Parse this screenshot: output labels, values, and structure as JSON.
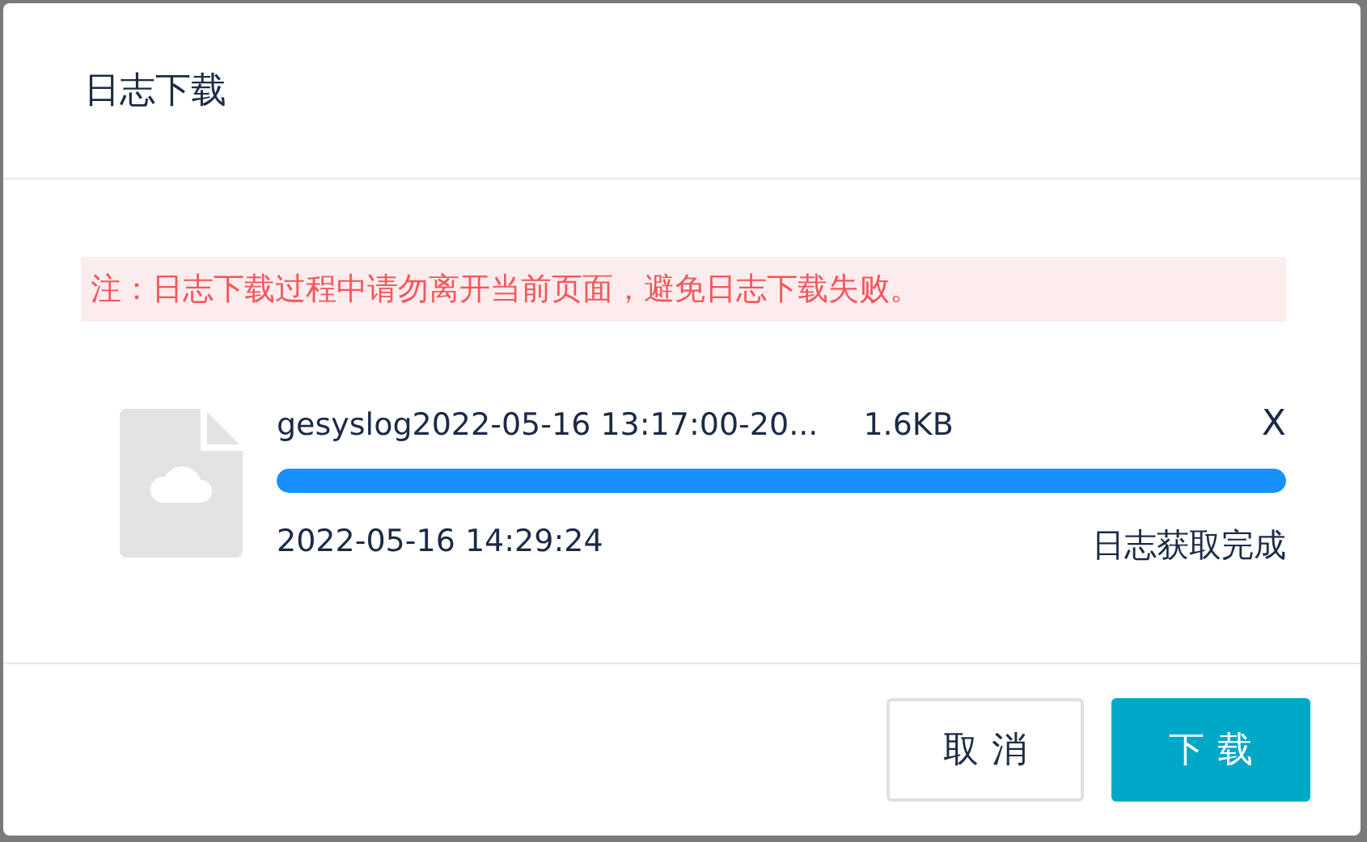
{
  "dialog": {
    "title": "日志下载"
  },
  "notice": "注：日志下载过程中请勿离开当前页面，避免日志下载失败。",
  "file": {
    "name": "gesyslog2022-05-16 13:17:00-20...",
    "size": "1.6KB",
    "close": "X",
    "level": 1,
    "time": "2022-05-16 14:29:24",
    "status": "日志获取完成"
  },
  "buttons": [
    {
      "label": "取消",
      "kind": "secondary"
    },
    {
      "label": "下载",
      "kind": "primary"
    }
  ]
}
